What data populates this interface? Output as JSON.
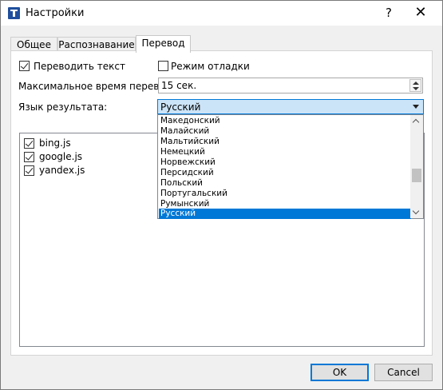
{
  "window": {
    "title": "Настройки",
    "help_label": "?",
    "close_label": "✕"
  },
  "tabs": [
    {
      "label": "Общее"
    },
    {
      "label": "Распознавание"
    },
    {
      "label": "Перевод",
      "active": true
    }
  ],
  "translate": {
    "translate_text_label": "Переводить текст",
    "translate_text_checked": true,
    "debug_mode_label": "Режим отладки",
    "debug_mode_checked": false,
    "max_time_label": "Максимальное время перевода:",
    "max_time_value": "15 сек.",
    "result_lang_label": "Язык результата:",
    "result_lang_value": "Русский"
  },
  "language_dropdown": {
    "items": [
      "Македонский",
      "Малайский",
      "Мальтийский",
      "Немецкий",
      "Норвежский",
      "Персидский",
      "Польский",
      "Португальский",
      "Румынский",
      "Русский"
    ],
    "selected": "Русский"
  },
  "engines": [
    {
      "name": "bing.js",
      "checked": true
    },
    {
      "name": "google.js",
      "checked": true
    },
    {
      "name": "yandex.js",
      "checked": true
    }
  ],
  "buttons": {
    "ok": "OK",
    "cancel": "Cancel"
  },
  "colors": {
    "accent": "#0078d7",
    "selected_bg": "#cce4f7"
  }
}
